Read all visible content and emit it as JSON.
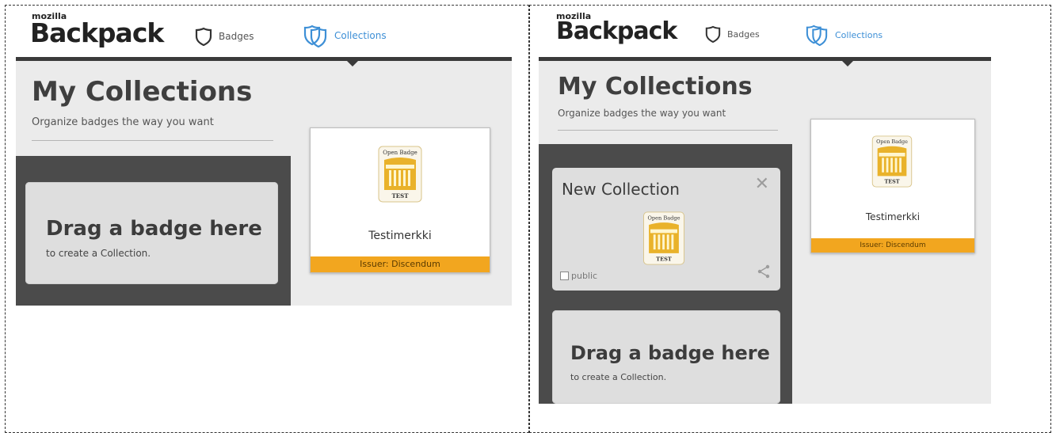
{
  "left": {
    "logo_small": "mozilla",
    "logo_big": "Backpack",
    "nav": {
      "badges": "Badges",
      "collections": "Collections"
    },
    "page_title": "My Collections",
    "page_subtitle": "Organize badges the way you want",
    "drop_title": "Drag a badge here",
    "drop_sub": "to create a Collection.",
    "badge": {
      "name": "Testimerkki",
      "issuer": "Issuer: Discendum"
    }
  },
  "right": {
    "logo_small": "mozilla",
    "logo_big": "Backpack",
    "nav": {
      "badges": "Badges",
      "collections": "Collections"
    },
    "page_title": "My Collections",
    "page_subtitle": "Organize badges the way you want",
    "collection": {
      "title": "New Collection",
      "public_label": "public"
    },
    "drop_title": "Drag a badge here",
    "drop_sub": "to create a Collection.",
    "badge": {
      "name": "Testimerkki",
      "issuer": "Issuer: Discendum"
    }
  },
  "badge_image_text": {
    "top": "Open Badge",
    "bottom": "TEST"
  },
  "colors": {
    "accent": "#3d8fd6",
    "issuer_bar": "#f2a61f",
    "header_bar": "#3a3a3a"
  }
}
